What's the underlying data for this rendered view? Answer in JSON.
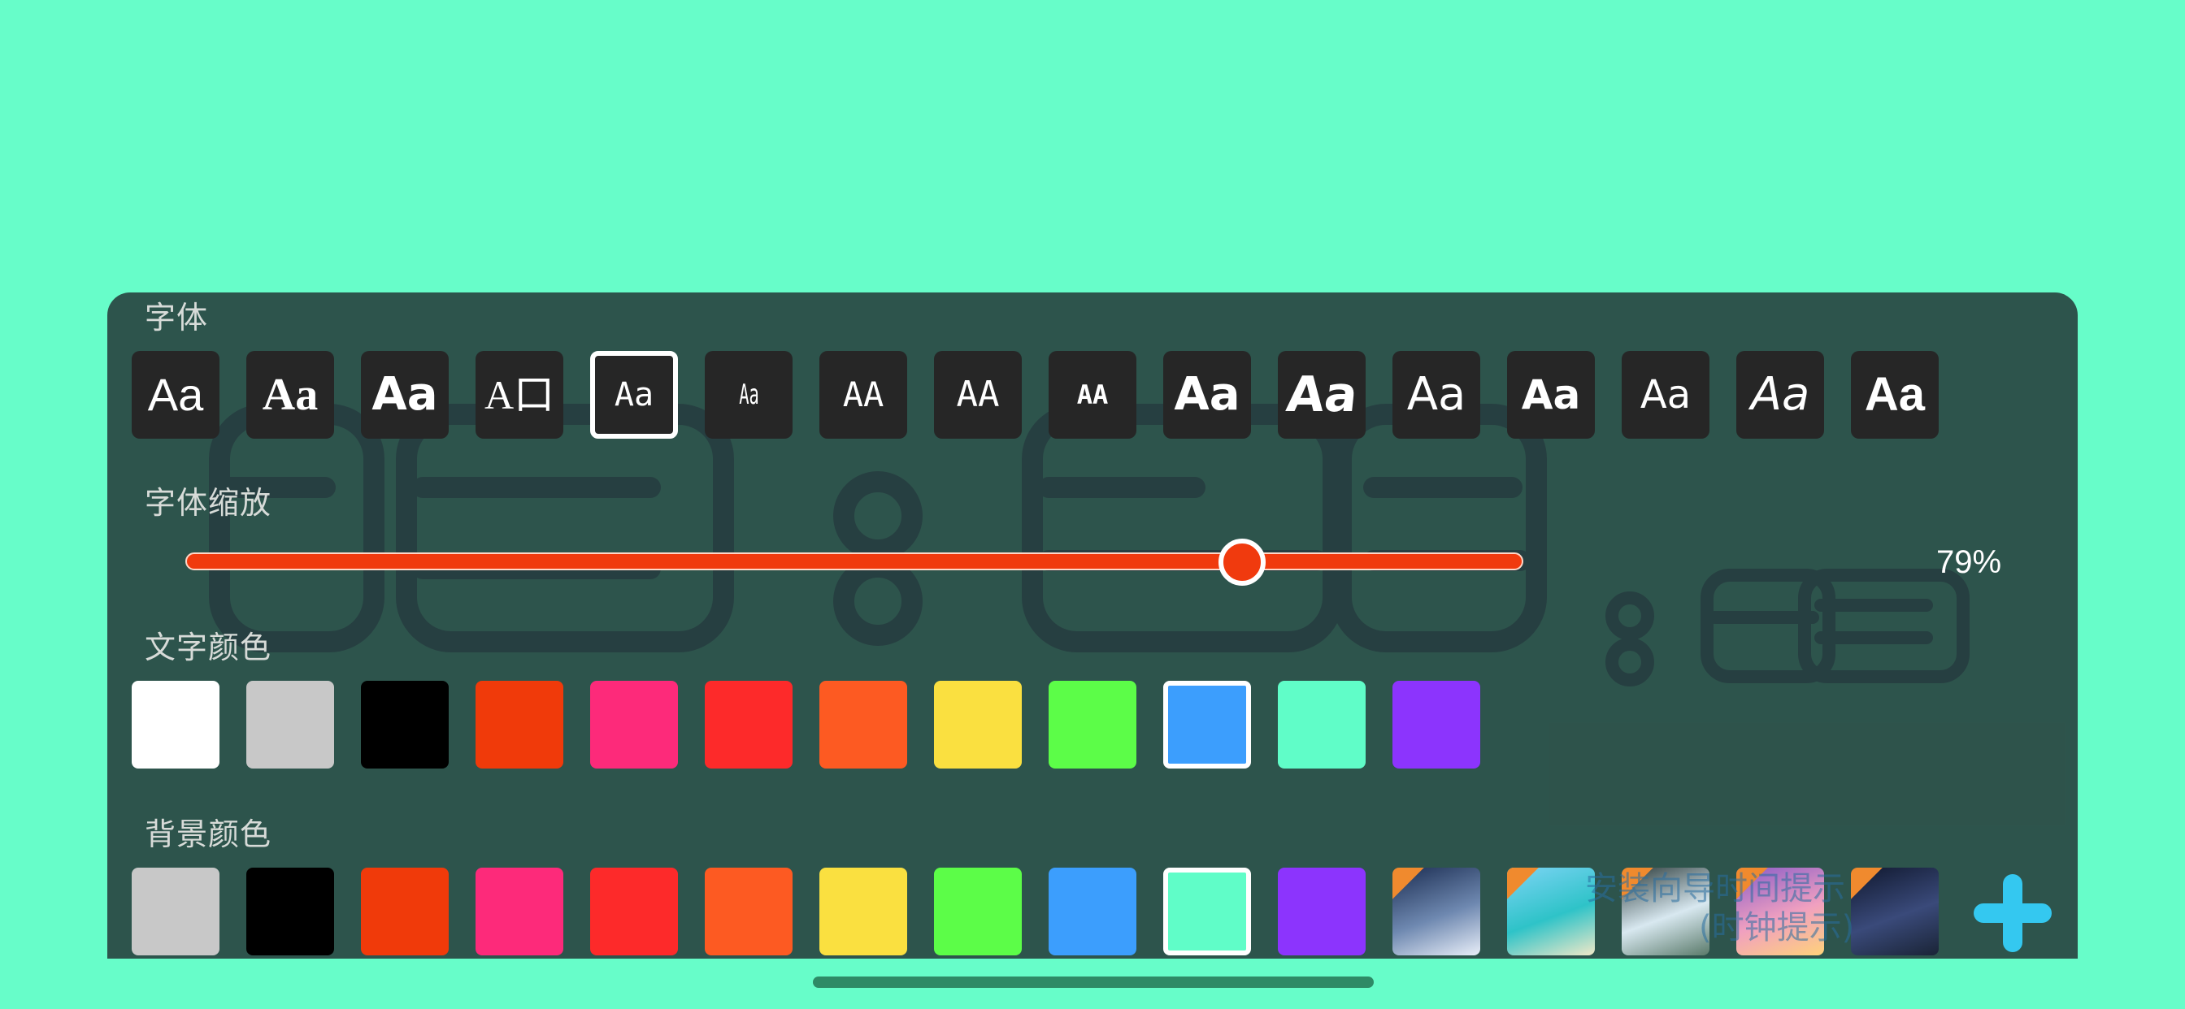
{
  "clock": {
    "digits": [
      "0",
      "8",
      "0",
      "8",
      "0",
      "8"
    ],
    "digit_color": "#2C4A6E"
  },
  "font_section": {
    "label": "字体",
    "tiles": [
      {
        "glyph": "Aa",
        "selected": false
      },
      {
        "glyph": "Aa",
        "selected": false
      },
      {
        "glyph": "Aa",
        "selected": false
      },
      {
        "glyph": "A口",
        "selected": false
      },
      {
        "glyph": "Aa",
        "selected": true
      },
      {
        "glyph": "Aa",
        "selected": false
      },
      {
        "glyph": "AA",
        "selected": false
      },
      {
        "glyph": "AA",
        "selected": false
      },
      {
        "glyph": "AA",
        "selected": false
      },
      {
        "glyph": "Aa",
        "selected": false
      },
      {
        "glyph": "Aa",
        "selected": false
      },
      {
        "glyph": "Aa",
        "selected": false
      },
      {
        "glyph": "Aa",
        "selected": false
      },
      {
        "glyph": "Aa",
        "selected": false
      },
      {
        "glyph": "Aa",
        "selected": false
      },
      {
        "glyph": "Aa",
        "selected": false
      }
    ]
  },
  "scale_section": {
    "label": "字体缩放",
    "value": 0.79,
    "value_text": "79%",
    "track_color": "#F03A0E"
  },
  "text_color_section": {
    "label": "文字颜色",
    "colors": [
      "#FFFFFF",
      "#C8C8C8",
      "#000000",
      "#F03A0A",
      "#FD2A7A",
      "#FD2A2A",
      "#FD5A22",
      "#FAE040",
      "#5CFD48",
      "#3C9EFD",
      "#60FDC8",
      "#8C34FD"
    ],
    "selected_index": 9
  },
  "background_section": {
    "label": "背景颜色",
    "colors": [
      "#C8C8C8",
      "#000000",
      "#F03A0A",
      "#FD2A7A",
      "#FD2A2A",
      "#FD5A22",
      "#FAE040",
      "#5CFD48",
      "#3C9EFD",
      "#60FDC8",
      "#8C34FD"
    ],
    "selected_index": 9,
    "images": [
      {
        "name": "snowy-mountain-night",
        "colors": [
          "#1B2D52",
          "#6E88B0",
          "#E8EEF8"
        ]
      },
      {
        "name": "tropical-beach",
        "colors": [
          "#7DD4F5",
          "#2EC3C8",
          "#F0E8C8"
        ]
      },
      {
        "name": "waterfall",
        "colors": [
          "#2A3A3A",
          "#D8E8F0",
          "#5A7A6A"
        ]
      },
      {
        "name": "sunset-clouds",
        "colors": [
          "#8A5CC8",
          "#F0A0C0",
          "#FFD27A"
        ]
      },
      {
        "name": "starry-night-sky",
        "colors": [
          "#10182E",
          "#3A4A7A",
          "#1A2436"
        ]
      }
    ]
  },
  "promo": {
    "line1": "安装向导时间提示",
    "line2": "(时钟提示)"
  },
  "add_button": {
    "icon": "plus-icon",
    "color": "#34C8F0"
  }
}
